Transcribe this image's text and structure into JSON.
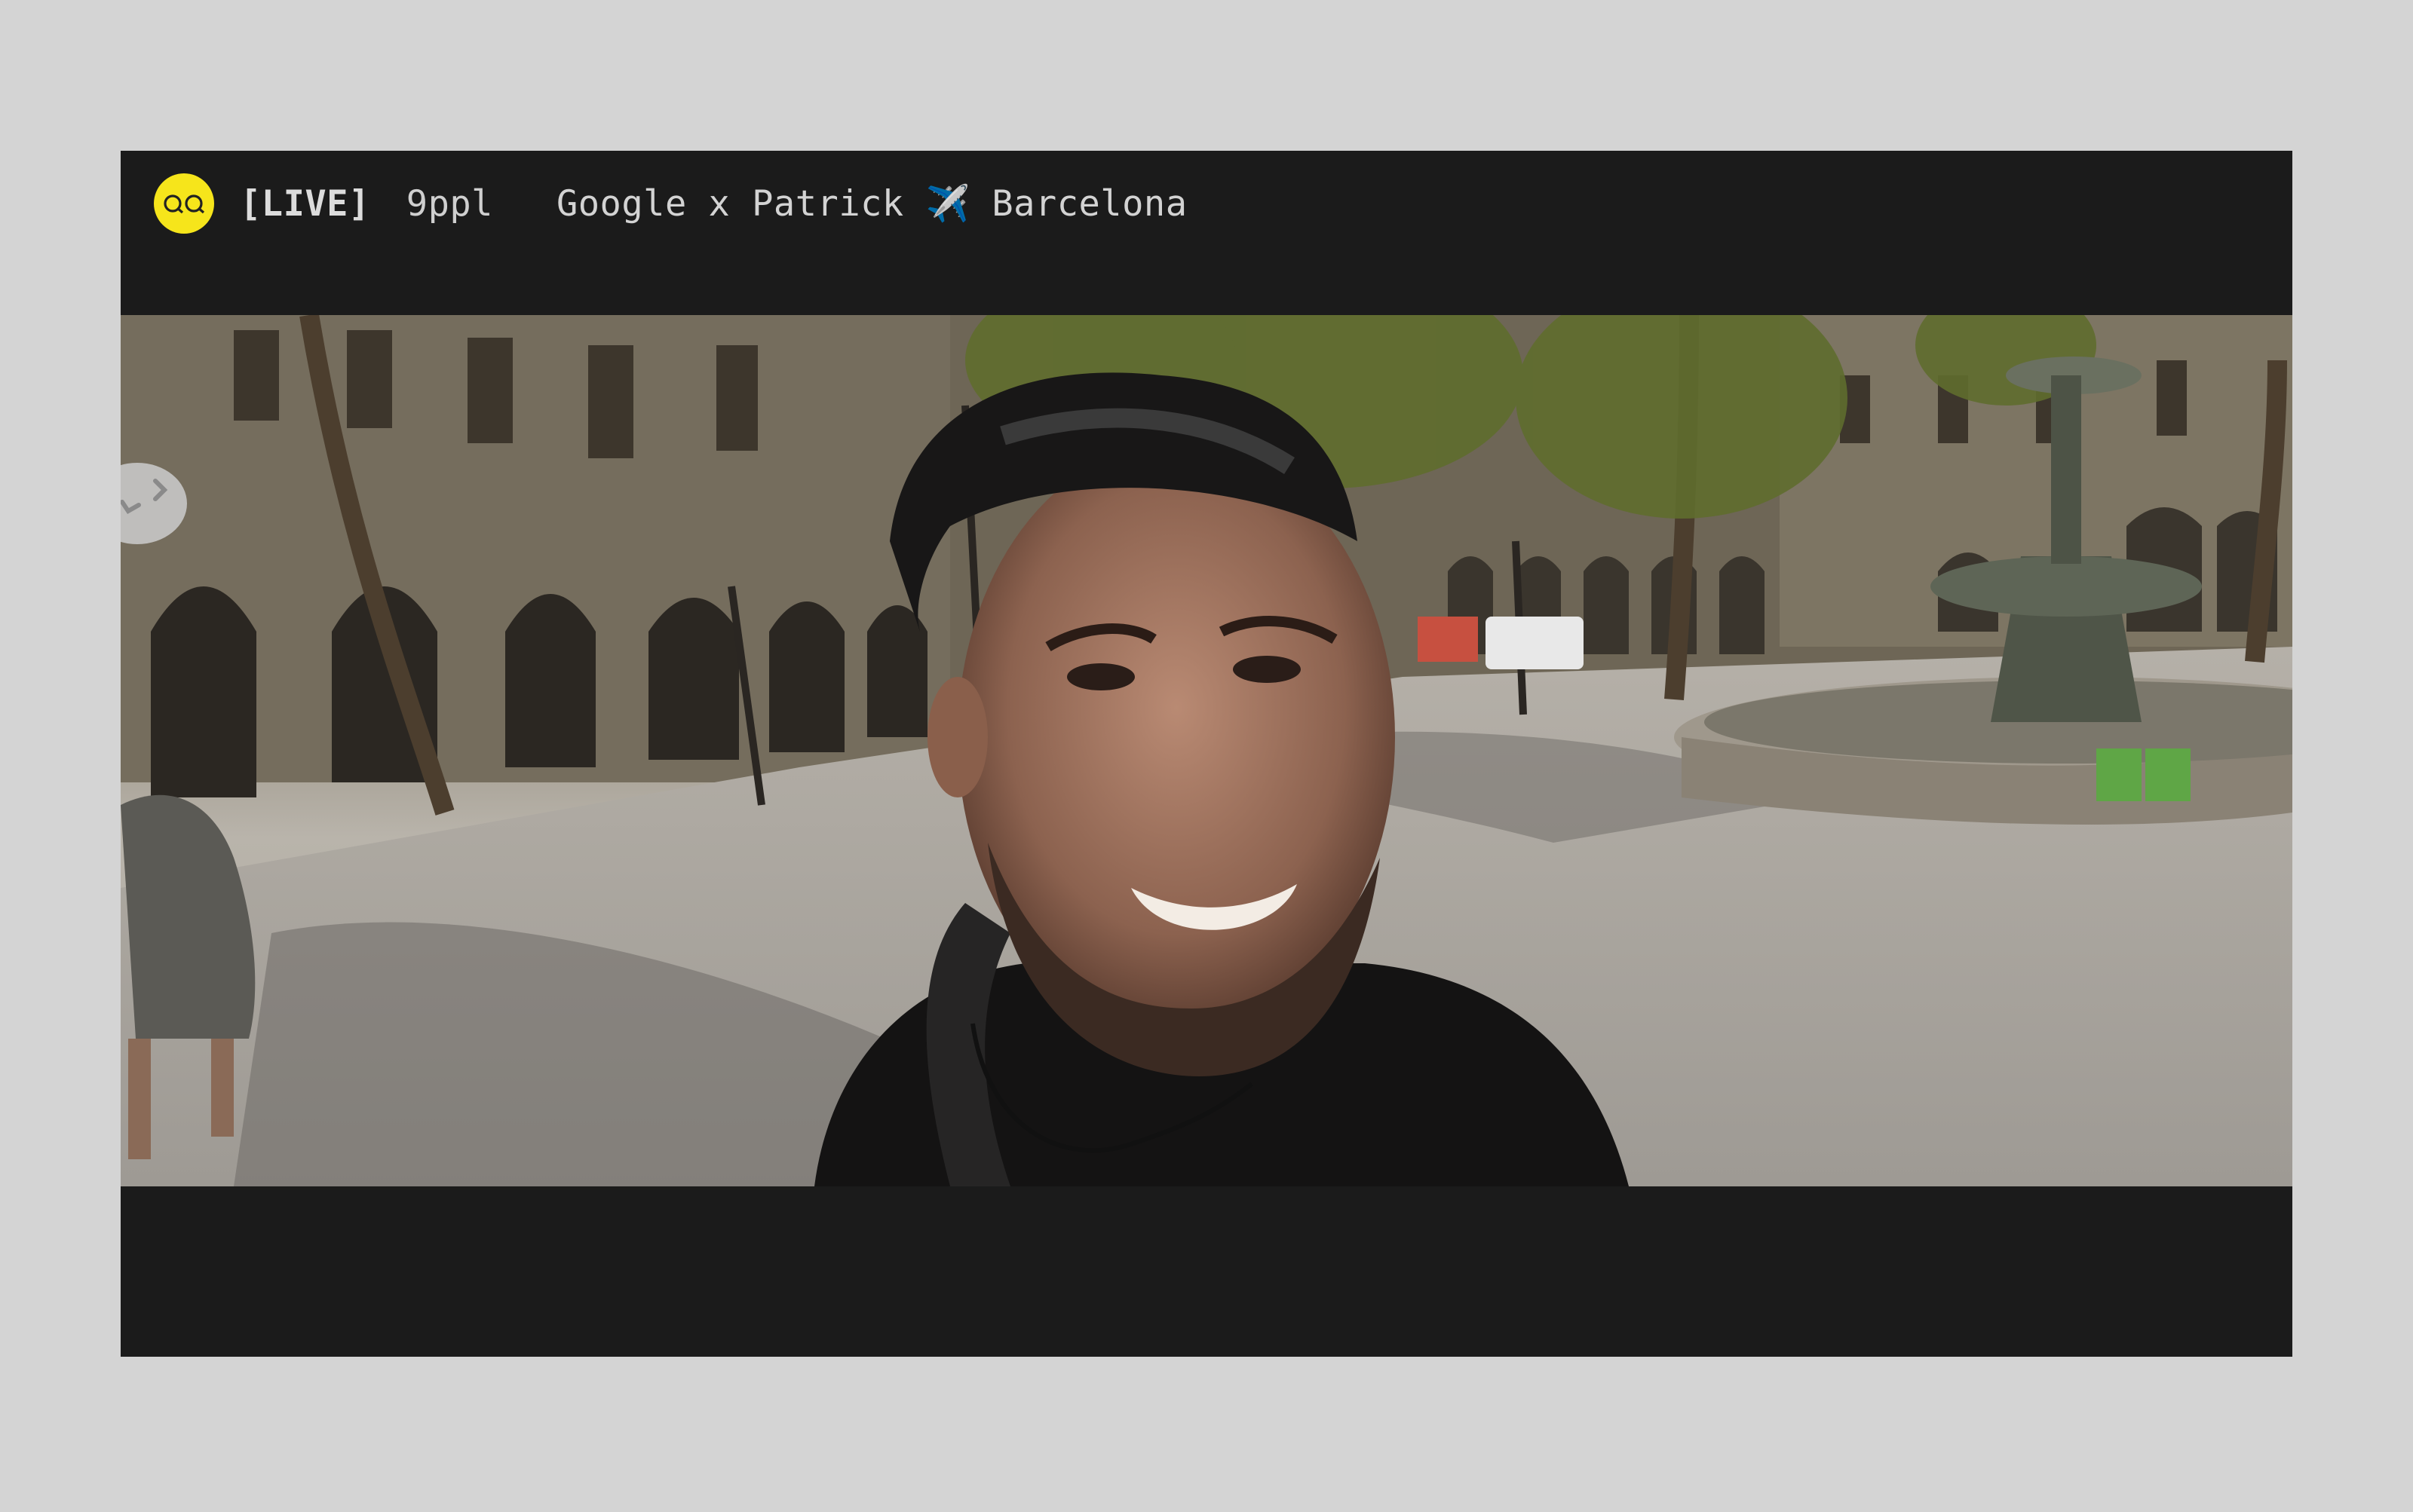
{
  "header": {
    "logo_icon": "double-quote-eyes-icon",
    "live_label": "[LIVE]",
    "viewer_count": "9ppl",
    "stream_title": "Google x Patrick ✈️ Barcelona"
  },
  "video": {
    "description_icon": "video-frame",
    "expand_icon": "expand-arrows-icon"
  },
  "colors": {
    "page_background": "#d4d4d4",
    "player_background": "#1b1b1b",
    "logo_yellow": "#f6e51b",
    "header_text": "#d6d6d6"
  }
}
